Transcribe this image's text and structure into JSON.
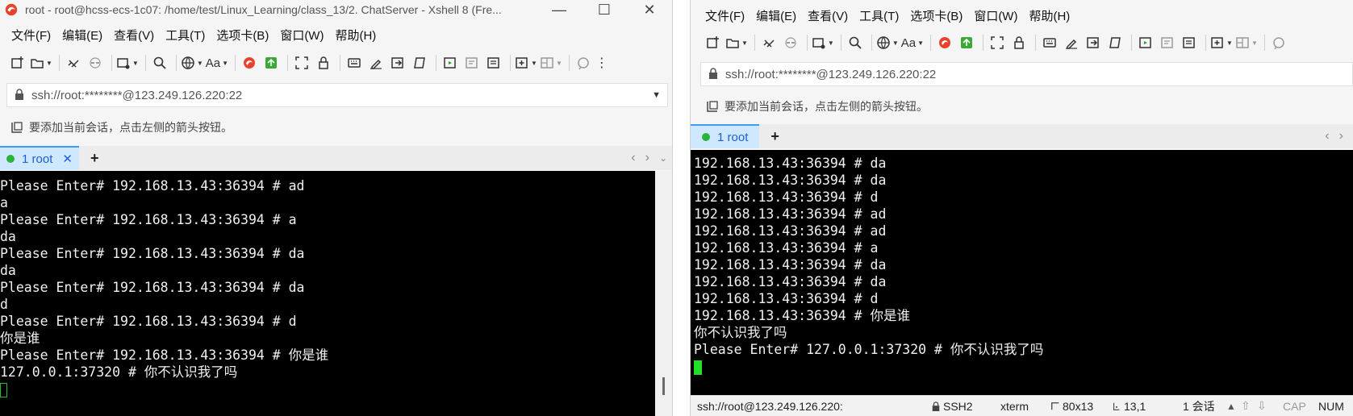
{
  "left": {
    "title": "root - root@hcss-ecs-1c07: /home/test/Linux_Learning/class_13/2. ChatServer - Xshell 8 (Fre...",
    "menu": [
      "文件(F)",
      "编辑(E)",
      "查看(V)",
      "工具(T)",
      "选项卡(B)",
      "窗口(W)",
      "帮助(H)"
    ],
    "address": "ssh://root:********@123.249.126.220:22",
    "hint": "要添加当前会话，点击左侧的箭头按钮。",
    "tab": {
      "label": "1 root",
      "close": "✕",
      "add": "+"
    },
    "terminal_lines": [
      "Please Enter# 192.168.13.43:36394 # ad",
      "a",
      "Please Enter# 192.168.13.43:36394 # a",
      "da",
      "Please Enter# 192.168.13.43:36394 # da",
      "da",
      "Please Enter# 192.168.13.43:36394 # da",
      "d",
      "Please Enter# 192.168.13.43:36394 # d",
      "你是谁",
      "Please Enter# 192.168.13.43:36394 # 你是谁",
      "127.0.0.1:37320 # 你不认识我了吗"
    ]
  },
  "right": {
    "menu": [
      "文件(F)",
      "编辑(E)",
      "查看(V)",
      "工具(T)",
      "选项卡(B)",
      "窗口(W)",
      "帮助(H)"
    ],
    "address": "ssh://root:********@123.249.126.220:22",
    "hint": "要添加当前会话，点击左侧的箭头按钮。",
    "tab": {
      "label": "1 root",
      "add": "+"
    },
    "terminal_lines": [
      "192.168.13.43:36394 # da",
      "192.168.13.43:36394 # da",
      "192.168.13.43:36394 # d",
      "192.168.13.43:36394 # ad",
      "192.168.13.43:36394 # ad",
      "192.168.13.43:36394 # a",
      "192.168.13.43:36394 # da",
      "192.168.13.43:36394 # da",
      "192.168.13.43:36394 # d",
      "192.168.13.43:36394 # 你是谁",
      "你不认识我了吗",
      "Please Enter# 127.0.0.1:37320 # 你不认识我了吗"
    ],
    "status": {
      "connection": "ssh://root@123.249.126.220:",
      "protocol": "SSH2",
      "term": "xterm",
      "size": "80x13",
      "position": "13,1",
      "sessions": "1 会话",
      "cap": "CAP",
      "num": "NUM"
    }
  },
  "colors": {
    "terminal_bg": "#000000",
    "terminal_fg": "#f0f0f0",
    "cursor": "#22e02a",
    "tab_active_bg": "#cfe8ff",
    "tab_text": "#1c5fd6",
    "session_dot": "#29b33a"
  }
}
